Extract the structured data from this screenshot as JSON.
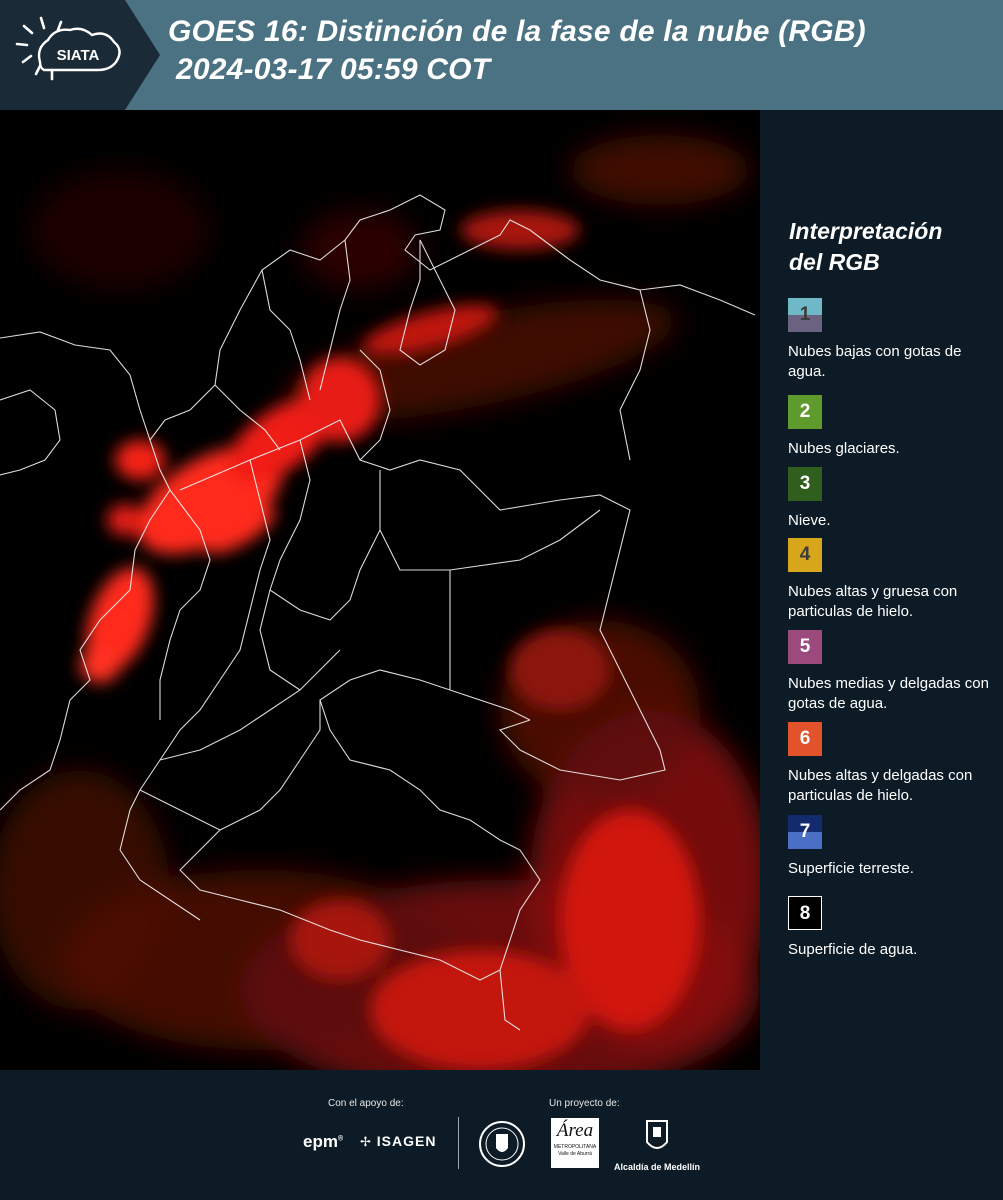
{
  "header": {
    "logo_text": "SIATA",
    "title": "GOES 16: Distinción de la fase de la nube (RGB)",
    "subtitle": "2024-03-17 05:59 COT"
  },
  "legend": {
    "title_line1": "Interpretación",
    "title_line2": "del RGB",
    "items": [
      {
        "num": "1",
        "label": "Nubes bajas con gotas de agua.",
        "color_top": "#6fb8c8",
        "color_bottom": "#6b6281"
      },
      {
        "num": "2",
        "label": "Nubes glaciares.",
        "color_top": "#5f9a2c",
        "color_bottom": "#5f9a2c"
      },
      {
        "num": "3",
        "label": "Nieve.",
        "color_top": "#2f5e1d",
        "color_bottom": "#2f5e1d"
      },
      {
        "num": "4",
        "label": "Nubes altas y gruesa con particulas de hielo.",
        "color_top": "#d8a61a",
        "color_bottom": "#d8a61a"
      },
      {
        "num": "5",
        "label": "Nubes medias y delgadas con gotas de agua.",
        "color_top": "#9c4a7e",
        "color_bottom": "#9c4a7e"
      },
      {
        "num": "6",
        "label": "Nubes altas y delgadas con particulas de hielo.",
        "color_top": "#e2532b",
        "color_bottom": "#e2532b"
      },
      {
        "num": "7",
        "label": "Superficie terreste.",
        "color_top": "#132a6e",
        "color_bottom": "#4a6fc4"
      },
      {
        "num": "8",
        "label": "Superficie de agua.",
        "color_top": "#000000",
        "color_bottom": "#000000"
      }
    ]
  },
  "footer": {
    "support_label": "Con el apoyo de:",
    "project_label": "Un proyecto de:",
    "epm": "epm",
    "isagen": "ISAGEN",
    "area_logo_main": "Área",
    "area_logo_sub1": "METROPOLITANA",
    "area_logo_sub2": "Valle de Aburrá",
    "alcaldia": "Alcaldía de Medellín"
  }
}
